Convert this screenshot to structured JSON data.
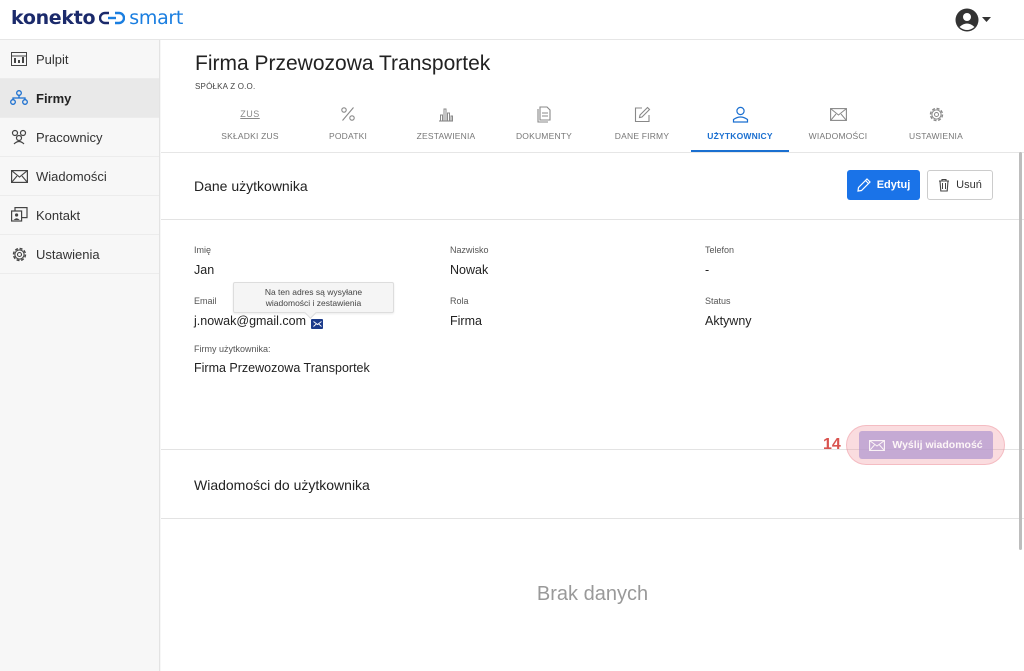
{
  "logo": {
    "part1": "konekto",
    "part2": "smart"
  },
  "sidebar": {
    "items": [
      {
        "label": "Pulpit",
        "icon": "dashboard-icon"
      },
      {
        "label": "Firmy",
        "icon": "org-chart-icon",
        "active": true
      },
      {
        "label": "Pracownicy",
        "icon": "people-icon"
      },
      {
        "label": "Wiadomości",
        "icon": "envelope-icon"
      },
      {
        "label": "Kontakt",
        "icon": "contact-icon"
      },
      {
        "label": "Ustawienia",
        "icon": "gear-icon"
      }
    ]
  },
  "company": {
    "name": "Firma Przewozowa Transportek",
    "type": "SPÓŁKA Z O.O."
  },
  "tabs": [
    {
      "label": "SKŁADKI ZUS",
      "icon": "zus-icon",
      "icon_text": "ZUS"
    },
    {
      "label": "PODATKI",
      "icon": "percent-icon"
    },
    {
      "label": "ZESTAWIENIA",
      "icon": "bar-chart-icon"
    },
    {
      "label": "DOKUMENTY",
      "icon": "documents-icon"
    },
    {
      "label": "DANE FIRMY",
      "icon": "edit-icon"
    },
    {
      "label": "UŻYTKOWNICY",
      "icon": "user-icon",
      "active": true
    },
    {
      "label": "WIADOMOŚCI",
      "icon": "envelope-icon"
    },
    {
      "label": "USTAWIENIA",
      "icon": "gear-icon"
    }
  ],
  "user_section": {
    "title": "Dane użytkownika",
    "edit_label": "Edytuj",
    "delete_label": "Usuń"
  },
  "fields": {
    "first_name": {
      "label": "Imię",
      "value": "Jan"
    },
    "last_name": {
      "label": "Nazwisko",
      "value": "Nowak"
    },
    "phone": {
      "label": "Telefon",
      "value": "-"
    },
    "email": {
      "label": "Email",
      "value": "j.nowak@gmail.com"
    },
    "role": {
      "label": "Rola",
      "value": "Firma"
    },
    "status": {
      "label": "Status",
      "value": "Aktywny"
    },
    "companies": {
      "label": "Firmy użytkownika:",
      "value": "Firma Przewozowa Transportek"
    }
  },
  "tooltip": {
    "line1": "Na ten adres są wysyłane",
    "line2": "wiadomości i zestawienia"
  },
  "messages_section": {
    "title": "Wiadomości do użytkownika",
    "step_number": "14",
    "send_label": "Wyślij wiadomość",
    "empty_text": "Brak danych"
  },
  "colors": {
    "primary": "#1a73e8",
    "active_tab": "#1a6fd0",
    "step": "#d9534f",
    "disabled_btn": "#b49ad1"
  }
}
